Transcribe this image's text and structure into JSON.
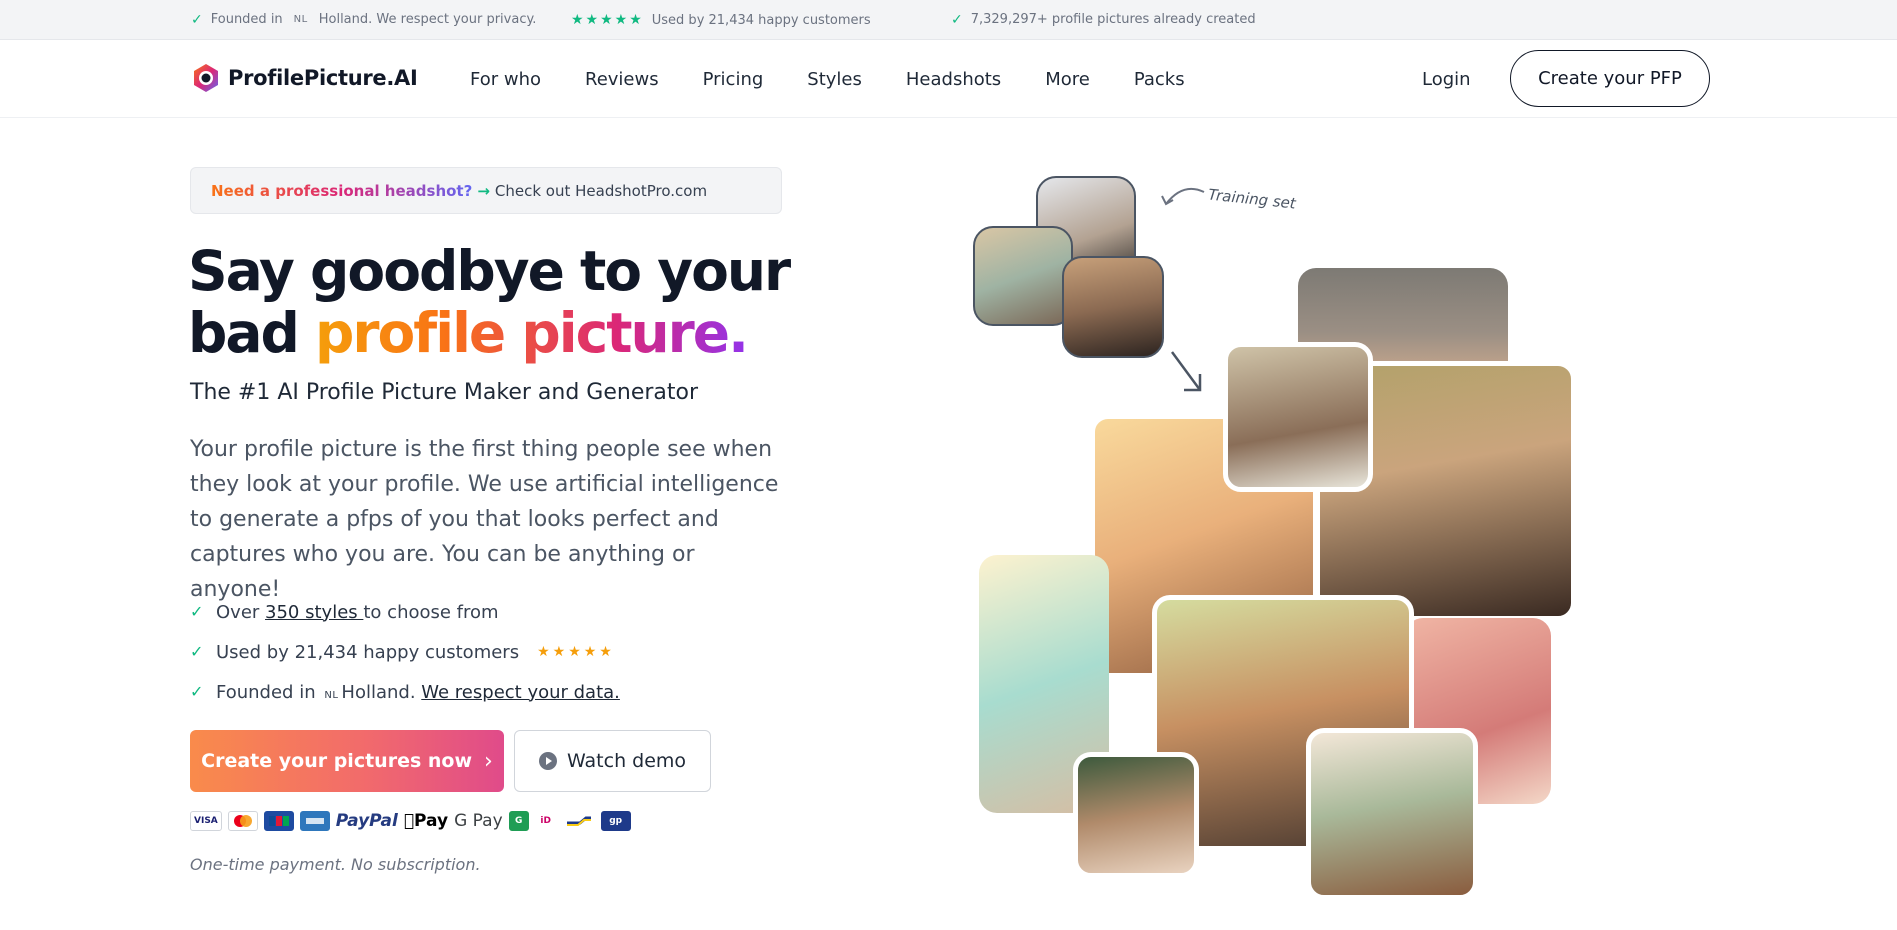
{
  "topbar": {
    "item1_pre": "Founded in",
    "item1_nl": "NL",
    "item1_post": "Holland. We respect your privacy.",
    "stars": "★★★★★",
    "item2": "Used by 21,434 happy customers",
    "item3": "7,329,297+ profile pictures already created"
  },
  "header": {
    "brand": "ProfilePicture.AI",
    "nav": [
      "For who",
      "Reviews",
      "Pricing",
      "Styles",
      "Headshots",
      "More",
      "Packs"
    ],
    "login": "Login",
    "cta": "Create your PFP"
  },
  "promo": {
    "highlight": "Need a professional headshot?",
    "arrow": "→",
    "rest": "Check out HeadshotPro.com"
  },
  "hero": {
    "title_line1": "Say goodbye to your",
    "title_line2_plain": "bad ",
    "title_line2_grad": "profile picture.",
    "subtitle": "The #1 AI Profile Picture Maker and Generator",
    "description": "Your profile picture is the first thing people see when they look at your profile. We use artificial intelligence to generate a pfps of you that looks perfect and captures who you are. You can be anything or anyone!"
  },
  "features": {
    "f1_pre": "Over ",
    "f1_link": "350 styles ",
    "f1_post": "to choose from",
    "f2": "Used by 21,434 happy customers",
    "f2_stars": "★★★★★",
    "f3_pre": "Founded in",
    "f3_nl": "NL",
    "f3_mid": "Holland. ",
    "f3_link": "We respect your data."
  },
  "actions": {
    "primary": "Create your pictures now",
    "primary_chevron": "›",
    "secondary": "Watch demo"
  },
  "payments": {
    "visa": "VISA",
    "paypal": "PayPal",
    "applepay": "Pay",
    "gpay": "G Pay",
    "g": "G",
    "ideal": "iD",
    "gp": "gp"
  },
  "note": "One-time payment. No subscription.",
  "collage": {
    "annotation": "Training set"
  }
}
